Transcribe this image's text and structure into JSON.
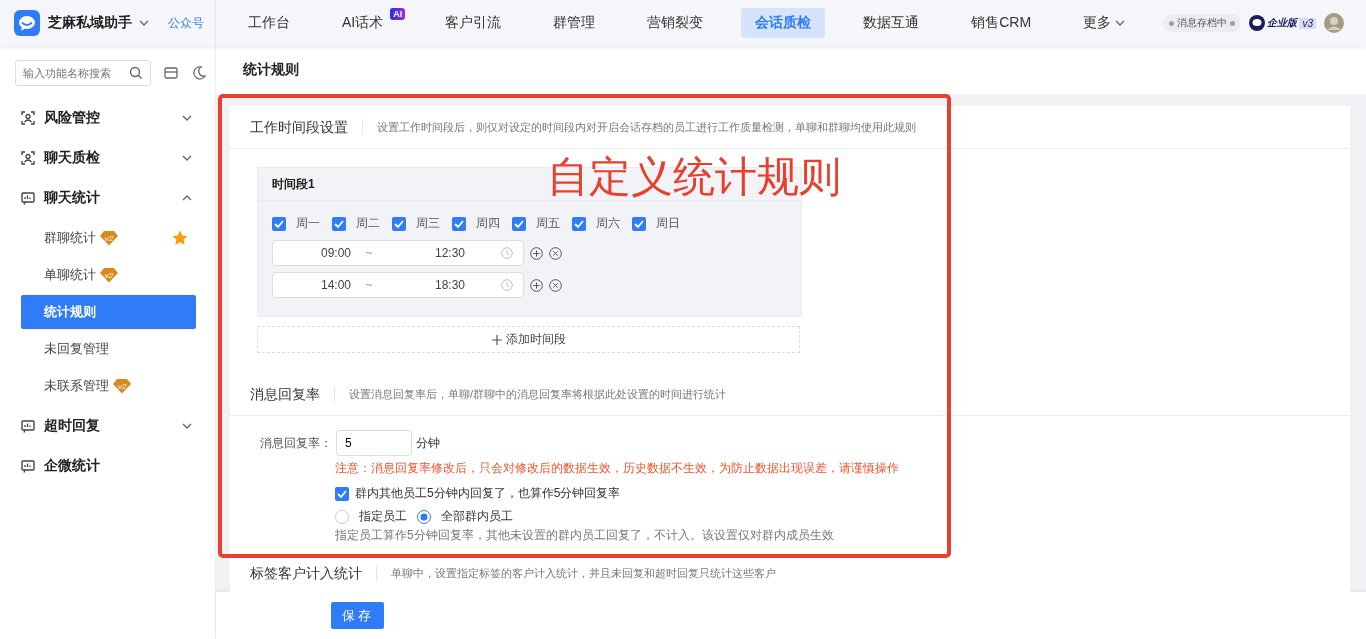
{
  "app": {
    "name": "芝麻私域助手",
    "account_link": "公众号"
  },
  "nav": [
    {
      "label": "工作台",
      "selected": false
    },
    {
      "label": "AI话术",
      "selected": false,
      "badge": "AI"
    },
    {
      "label": "客户引流",
      "selected": false
    },
    {
      "label": "群管理",
      "selected": false
    },
    {
      "label": "营销裂变",
      "selected": false
    },
    {
      "label": "会话质检",
      "selected": true
    },
    {
      "label": "数据互通",
      "selected": false
    },
    {
      "label": "销售CRM",
      "selected": false
    },
    {
      "label": "更多",
      "selected": false,
      "dropdown": true
    }
  ],
  "header_right": {
    "archive_status": "消息存档中",
    "edition": "企业版",
    "version": "v3"
  },
  "sidebar": {
    "search_placeholder": "输入功能名称搜索",
    "items": [
      {
        "label": "风险管控",
        "kind": "scan",
        "expanded": false
      },
      {
        "label": "聊天质检",
        "kind": "scan",
        "expanded": false
      },
      {
        "label": "聊天统计",
        "kind": "chat",
        "expanded": true,
        "children": [
          {
            "label": "群聊统计",
            "badge": "v2",
            "starred": true,
            "selected": false
          },
          {
            "label": "单聊统计",
            "badge": "v2",
            "starred": false,
            "selected": false
          },
          {
            "label": "统计规则",
            "starred": false,
            "selected": true
          },
          {
            "label": "未回复管理",
            "starred": false,
            "selected": false
          },
          {
            "label": "未联系管理",
            "badge": "v2",
            "starred": false,
            "selected": false
          }
        ]
      },
      {
        "label": "超时回复",
        "kind": "chat",
        "expanded": false
      },
      {
        "label": "企微统计",
        "kind": "chat"
      }
    ]
  },
  "page_title": "统计规则",
  "sections": [
    {
      "kind": "periods",
      "title": "工作时间段设置",
      "description": "设置工作时间段后，则仅对设定的时间段内对开启会话存档的员工进行工作质量检测，单聊和群聊均使用此规则",
      "periods": [
        {
          "title": "时间段1",
          "days": [
            {
              "label": "周一",
              "checked": true
            },
            {
              "label": "周二",
              "checked": true
            },
            {
              "label": "周三",
              "checked": true
            },
            {
              "label": "周四",
              "checked": true
            },
            {
              "label": "周五",
              "checked": true
            },
            {
              "label": "周六",
              "checked": true
            },
            {
              "label": "周日",
              "checked": true
            }
          ],
          "ranges": [
            {
              "start": "09:00",
              "separator": "~",
              "end": "12:30"
            },
            {
              "start": "14:00",
              "separator": "~",
              "end": "18:30"
            }
          ]
        }
      ],
      "add_label": "添加时间段"
    },
    {
      "kind": "reply",
      "title": "消息回复率",
      "description": "设置消息回复率后，单聊/群聊中的消息回复率将根据此处设置的时间进行统计",
      "field_label": "消息回复率：",
      "value": "5",
      "unit": "分钟",
      "warning": "注意：消息回复率修改后，只会对修改后的数据生效，历史数据不生效，为防止数据出现误差，请谨慎操作",
      "option": {
        "label": "群内其他员工5分钟内回复了，也算作5分钟回复率",
        "checked": true
      },
      "radios": [
        {
          "label": "指定员工",
          "selected": false
        },
        {
          "label": "全部群内员工",
          "selected": true
        }
      ],
      "hint": "指定员工算作5分钟回复率，其他未设置的群内员工回复了，不计入。该设置仅对群内成员生效"
    },
    {
      "kind": "header",
      "title": "标签客户计入统计",
      "description": "单聊中，设置指定标签的客户计入统计，并且未回复和超时回复只统计这些客户"
    }
  ],
  "annotation": {
    "text": "自定义统计规则"
  },
  "save_button": "保存"
}
